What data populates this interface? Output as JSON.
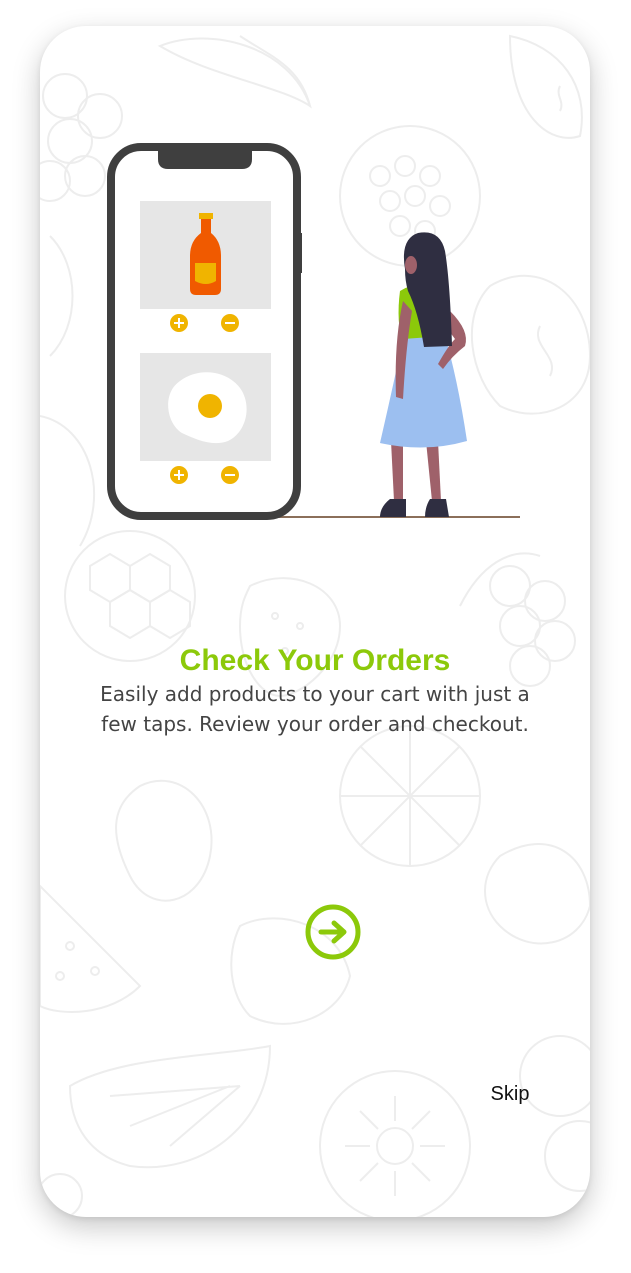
{
  "onboarding": {
    "title": "Check Your Orders",
    "description": "Easily add products to your cart with just a few taps. Review your order and checkout.",
    "skip_label": "Skip",
    "next_icon": "arrow-right-circle-icon"
  },
  "colors": {
    "accent": "#8cc90a",
    "text": "#444444",
    "phone_frame": "#3f3d56",
    "control_yellow": "#f0b400",
    "skirt": "#9cbff0",
    "hair": "#2f2e41",
    "ground": "#8b6f5a"
  },
  "hero": {
    "illustration": "woman-with-phone-order-illustration",
    "products": [
      "ketchup-bottle-icon",
      "fried-egg-icon"
    ]
  }
}
